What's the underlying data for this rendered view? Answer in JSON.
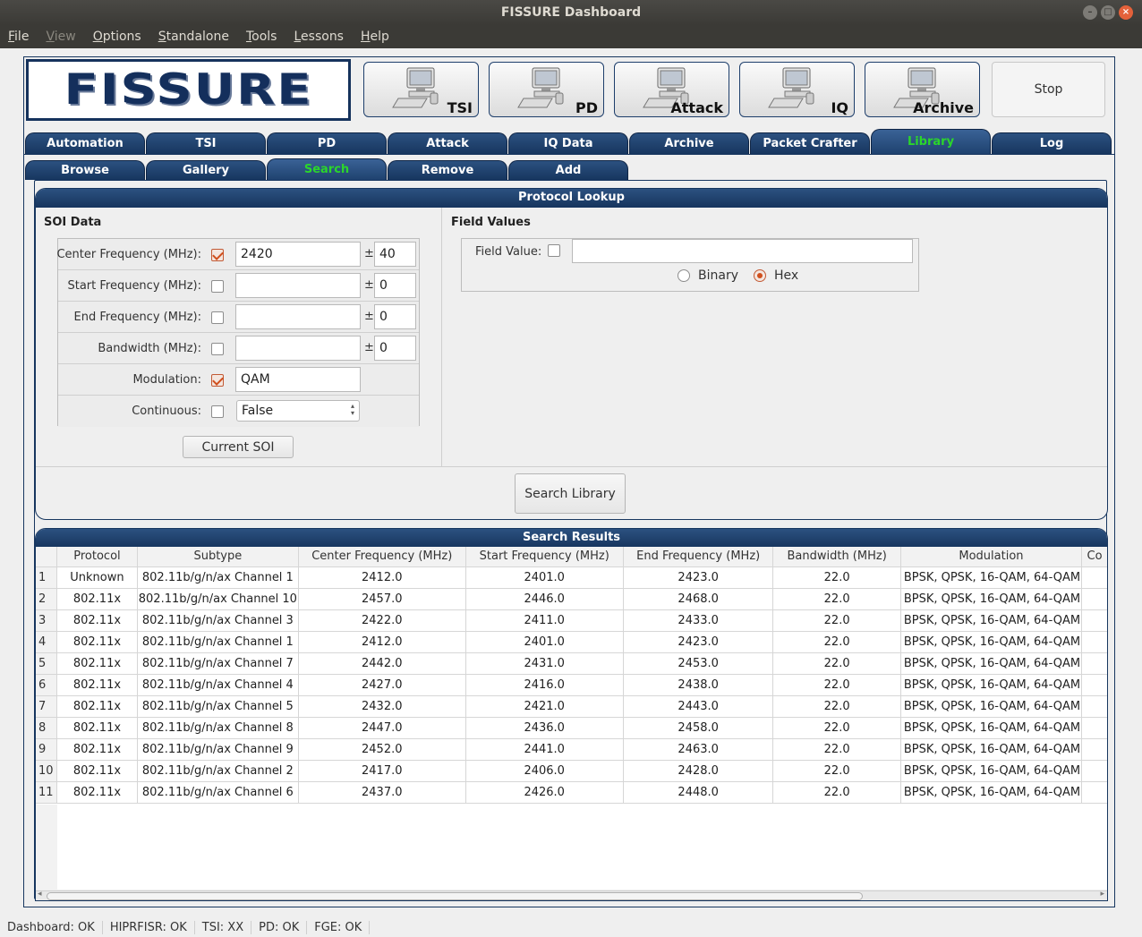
{
  "window": {
    "title": "FISSURE Dashboard"
  },
  "menu": [
    "File",
    "View",
    "Options",
    "Standalone",
    "Tools",
    "Lessons",
    "Help"
  ],
  "logo": {
    "text": "FISSURE"
  },
  "toolbar": {
    "buttons": [
      "TSI",
      "PD",
      "Attack",
      "IQ",
      "Archive"
    ],
    "stop_label": "Stop"
  },
  "main_tabs": [
    "Automation",
    "TSI",
    "PD",
    "Attack",
    "IQ Data",
    "Archive",
    "Packet Crafter",
    "Library",
    "Log"
  ],
  "active_main_tab": "Library",
  "library_tabs": [
    "Browse",
    "Gallery",
    "Search",
    "Remove",
    "Add"
  ],
  "active_library_tab": "Search",
  "protocol_lookup": {
    "title": "Protocol Lookup",
    "soi_title": "SOI Data",
    "fields": [
      {
        "label": "Center Frequency (MHz):",
        "checked": true,
        "value": "2420",
        "tol": "40"
      },
      {
        "label": "Start Frequency (MHz):",
        "checked": false,
        "value": "",
        "tol": "0"
      },
      {
        "label": "End Frequency (MHz):",
        "checked": false,
        "value": "",
        "tol": "0"
      },
      {
        "label": "Bandwidth (MHz):",
        "checked": false,
        "value": "",
        "tol": "0"
      },
      {
        "label": "Modulation:",
        "checked": true,
        "value": "QAM"
      },
      {
        "label": "Continuous:",
        "checked": false,
        "select": "False"
      }
    ],
    "pm": "±",
    "current_soi_label": "Current SOI",
    "field_values_title": "Field Values",
    "field_value_label": "Field Value:",
    "field_value": "",
    "radio_binary": "Binary",
    "radio_hex": "Hex",
    "selected_radio": "Hex",
    "search_button": "Search Library"
  },
  "results": {
    "title": "Search Results",
    "columns": [
      "Protocol",
      "Subtype",
      "Center Frequency (MHz)",
      "Start Frequency (MHz)",
      "End Frequency (MHz)",
      "Bandwidth (MHz)",
      "Modulation",
      "Co"
    ],
    "rows": [
      [
        "1",
        "Unknown",
        "802.11b/g/n/ax Channel 1",
        "2412.0",
        "2401.0",
        "2423.0",
        "22.0",
        "BPSK, QPSK, 16-QAM, 64-QAM"
      ],
      [
        "2",
        "802.11x",
        "802.11b/g/n/ax Channel 10",
        "2457.0",
        "2446.0",
        "2468.0",
        "22.0",
        "BPSK, QPSK, 16-QAM, 64-QAM"
      ],
      [
        "3",
        "802.11x",
        "802.11b/g/n/ax Channel 3",
        "2422.0",
        "2411.0",
        "2433.0",
        "22.0",
        "BPSK, QPSK, 16-QAM, 64-QAM"
      ],
      [
        "4",
        "802.11x",
        "802.11b/g/n/ax Channel 1",
        "2412.0",
        "2401.0",
        "2423.0",
        "22.0",
        "BPSK, QPSK, 16-QAM, 64-QAM"
      ],
      [
        "5",
        "802.11x",
        "802.11b/g/n/ax Channel 7",
        "2442.0",
        "2431.0",
        "2453.0",
        "22.0",
        "BPSK, QPSK, 16-QAM, 64-QAM"
      ],
      [
        "6",
        "802.11x",
        "802.11b/g/n/ax Channel 4",
        "2427.0",
        "2416.0",
        "2438.0",
        "22.0",
        "BPSK, QPSK, 16-QAM, 64-QAM"
      ],
      [
        "7",
        "802.11x",
        "802.11b/g/n/ax Channel 5",
        "2432.0",
        "2421.0",
        "2443.0",
        "22.0",
        "BPSK, QPSK, 16-QAM, 64-QAM"
      ],
      [
        "8",
        "802.11x",
        "802.11b/g/n/ax Channel 8",
        "2447.0",
        "2436.0",
        "2458.0",
        "22.0",
        "BPSK, QPSK, 16-QAM, 64-QAM"
      ],
      [
        "9",
        "802.11x",
        "802.11b/g/n/ax Channel 9",
        "2452.0",
        "2441.0",
        "2463.0",
        "22.0",
        "BPSK, QPSK, 16-QAM, 64-QAM"
      ],
      [
        "10",
        "802.11x",
        "802.11b/g/n/ax Channel 2",
        "2417.0",
        "2406.0",
        "2428.0",
        "22.0",
        "BPSK, QPSK, 16-QAM, 64-QAM"
      ],
      [
        "11",
        "802.11x",
        "802.11b/g/n/ax Channel 6",
        "2437.0",
        "2426.0",
        "2448.0",
        "22.0",
        "BPSK, QPSK, 16-QAM, 64-QAM"
      ]
    ]
  },
  "status": [
    "Dashboard: OK",
    "HIPRFISR: OK",
    "TSI: XX",
    "PD: OK",
    "FGE: OK"
  ],
  "colors": {
    "navy": "#17365f",
    "active_tab_text": "#2bd62b",
    "check_accent": "#d04f1d"
  }
}
